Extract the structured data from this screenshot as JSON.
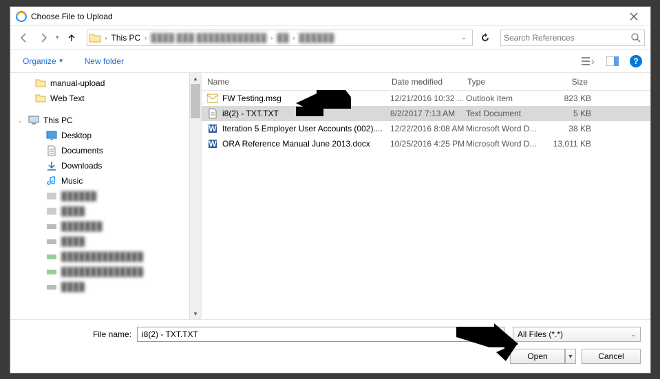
{
  "title": "Choose File to Upload",
  "address": {
    "root": "This PC",
    "blurred_segments": [
      "████ ███ ████████████",
      "██",
      "██████"
    ]
  },
  "search_placeholder": "Search References",
  "toolbar": {
    "organize": "Organize",
    "new_folder": "New folder"
  },
  "nav": {
    "quick": [
      {
        "label": "manual-upload",
        "icon": "folder"
      },
      {
        "label": "Web Text",
        "icon": "folder"
      }
    ],
    "this_pc": "This PC",
    "pc_children": [
      {
        "label": "Desktop",
        "icon": "desktop"
      },
      {
        "label": "Documents",
        "icon": "documents"
      },
      {
        "label": "Downloads",
        "icon": "downloads"
      },
      {
        "label": "Music",
        "icon": "music"
      }
    ],
    "blurred": [
      "██████",
      "████",
      "███████",
      "████",
      "██████████████",
      "██████████████",
      "████"
    ]
  },
  "columns": {
    "name": "Name",
    "date": "Date modified",
    "type": "Type",
    "size": "Size"
  },
  "files": [
    {
      "name": "FW Testing.msg",
      "date": "12/21/2016 10:32 ...",
      "type": "Outlook Item",
      "size": "823 KB",
      "icon": "outlook",
      "selected": false
    },
    {
      "name": "i8(2) - TXT.TXT",
      "date": "8/2/2017 7:13 AM",
      "type": "Text Document",
      "size": "5 KB",
      "icon": "txt",
      "selected": true
    },
    {
      "name": "Iteration 5 Employer User Accounts (002)....",
      "date": "12/22/2016 8:08 AM",
      "type": "Microsoft Word D...",
      "size": "38 KB",
      "icon": "word",
      "selected": false
    },
    {
      "name": "ORA Reference Manual June 2013.docx",
      "date": "10/25/2016 4:25 PM",
      "type": "Microsoft Word D...",
      "size": "13,011 KB",
      "icon": "word",
      "selected": false
    }
  ],
  "file_name_label": "File name:",
  "file_name_value": "i8(2) - TXT.TXT",
  "filter": "All Files (*.*)",
  "open": "Open",
  "cancel": "Cancel"
}
